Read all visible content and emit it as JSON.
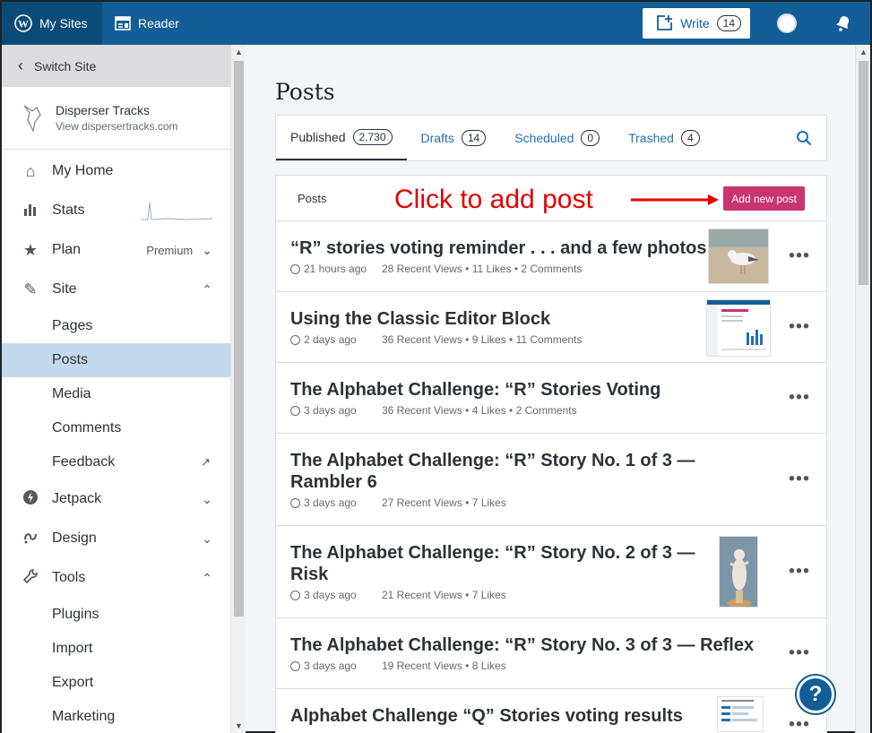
{
  "masterbar": {
    "mysites_label": "My Sites",
    "reader_label": "Reader",
    "write_label": "Write",
    "write_count": "14"
  },
  "sidebar": {
    "switch_site_label": "Switch Site",
    "site_name": "Disperser Tracks",
    "site_url": "View dispersertracks.com",
    "items": [
      {
        "label": "My Home",
        "icon": "home-icon"
      },
      {
        "label": "Stats",
        "icon": "stats-icon"
      },
      {
        "label": "Plan",
        "icon": "star-icon",
        "badge": "Premium"
      },
      {
        "label": "Site",
        "icon": "pencil-icon"
      },
      {
        "label": "Jetpack",
        "icon": "jetpack-icon"
      },
      {
        "label": "Design",
        "icon": "design-icon"
      },
      {
        "label": "Tools",
        "icon": "wrench-icon"
      }
    ],
    "site_sub": [
      "Pages",
      "Posts",
      "Media",
      "Comments",
      "Feedback"
    ],
    "tools_sub": [
      "Plugins",
      "Import",
      "Export",
      "Marketing"
    ]
  },
  "main": {
    "title": "Posts",
    "tabs": [
      {
        "label": "Published",
        "count": "2,730"
      },
      {
        "label": "Drafts",
        "count": "14"
      },
      {
        "label": "Scheduled",
        "count": "0"
      },
      {
        "label": "Trashed",
        "count": "4"
      }
    ],
    "list_header": "Posts",
    "annotation": "Click to add post",
    "add_button": "Add new post",
    "posts": [
      {
        "title": "“R” stories voting reminder . . . and a few photos",
        "time": "21 hours ago",
        "stats": "28 Recent Views • 11 Likes • 2 Comments"
      },
      {
        "title": "Using the Classic Editor Block",
        "time": "2 days ago",
        "stats": "36 Recent Views • 9 Likes • 11 Comments"
      },
      {
        "title": "The Alphabet Challenge: “R” Stories Voting",
        "time": "3 days ago",
        "stats": "36 Recent Views • 4 Likes • 2 Comments"
      },
      {
        "title": "The Alphabet Challenge: “R” Story No. 1 of 3 — Rambler 6",
        "time": "3 days ago",
        "stats": "27 Recent Views • 7 Likes"
      },
      {
        "title": "The Alphabet Challenge: “R” Story No. 2 of 3 — Risk",
        "time": "3 days ago",
        "stats": "21 Recent Views • 7 Likes"
      },
      {
        "title": "The Alphabet Challenge: “R” Story No. 3 of 3 — Reflex",
        "time": "3 days ago",
        "stats": "19 Recent Views • 8 Likes"
      },
      {
        "title": "Alphabet Challenge “Q” Stories voting results",
        "time": "",
        "stats": ""
      }
    ],
    "help_label": "?"
  },
  "colors": {
    "masterbar": "#135e96",
    "mysites_bg": "#0a4b78",
    "accent_link": "#2271b1",
    "add_button": "#c9356e",
    "annotation": "#e00000",
    "active_nav": "#c5d9ed"
  }
}
